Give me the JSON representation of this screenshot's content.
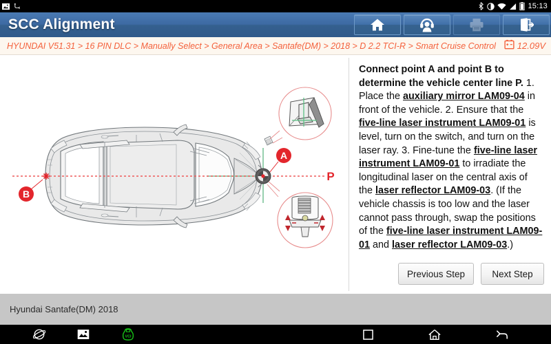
{
  "status_bar": {
    "icons": [
      "image-icon",
      "usb-debug-icon",
      "bluetooth-icon",
      "do-not-disturb-icon",
      "wifi-icon",
      "signal-icon",
      "battery-icon"
    ],
    "time": "15:13"
  },
  "header": {
    "title": "SCC Alignment",
    "buttons": [
      {
        "name": "home-button",
        "icon": "home-icon",
        "enabled": true
      },
      {
        "name": "support-button",
        "icon": "headset-icon",
        "enabled": true
      },
      {
        "name": "print-button",
        "icon": "printer-icon",
        "enabled": false
      },
      {
        "name": "exit-button",
        "icon": "exit-icon",
        "enabled": true
      }
    ]
  },
  "breadcrumb": {
    "path": "HYUNDAI V51.31 > 16 PIN DLC > Manually Select > General Area > Santafe(DM) > 2018 > D 2.2 TCI-R > Smart Cruise Control",
    "voltage": "12.09V",
    "voltage_icon": "battery-icon",
    "accent_color": "#f4613c"
  },
  "diagram": {
    "title": "vehicle-top-view-scc-alignment",
    "labels": {
      "point_a": "A",
      "point_b": "B",
      "center_line": "P"
    },
    "callouts": [
      {
        "name": "auxiliary-mirror-callout",
        "depicts": "auxiliary mirror LAM09-04"
      },
      {
        "name": "laser-instrument-callout",
        "depicts": "five-line laser instrument LAM09-01 tripod adjustment"
      }
    ],
    "colors": {
      "marker": "#e3262c",
      "center_line": "#ee5a5a",
      "laser_green": "#4cae6a",
      "callout_outline": "#e78b8b",
      "car_fill": "#e9e9e9",
      "car_stroke": "#6f7578"
    }
  },
  "instructions": {
    "heading": "Connect point A and point B to determine the vehicle center line P.",
    "steps": [
      {
        "number": "1.",
        "parts": [
          {
            "text": "Place the ",
            "style": "normal"
          },
          {
            "text": "auxiliary mirror LAM09-04",
            "style": "highlight"
          },
          {
            "text": " in front of the vehicle.",
            "style": "normal"
          }
        ]
      },
      {
        "number": "2.",
        "parts": [
          {
            "text": "Ensure that the ",
            "style": "normal"
          },
          {
            "text": "five-line laser instrument LAM09-01",
            "style": "highlight"
          },
          {
            "text": " is level, turn on the switch, and turn on the laser ray.",
            "style": "normal"
          }
        ]
      },
      {
        "number": "3.",
        "parts": [
          {
            "text": "Fine-tune the ",
            "style": "normal"
          },
          {
            "text": "five-line laser instrument LAM09-01",
            "style": "highlight"
          },
          {
            "text": " to irradiate the longitudinal laser on the central axis of the ",
            "style": "normal"
          },
          {
            "text": "laser reflector LAM09-03",
            "style": "highlight"
          },
          {
            "text": ". (If the vehicle chassis is too low and the laser cannot pass through, swap the positions of the ",
            "style": "normal"
          },
          {
            "text": "five-line laser instrument LAM09-01",
            "style": "highlight"
          },
          {
            "text": " and ",
            "style": "normal"
          },
          {
            "text": "laser reflector LAM09-03",
            "style": "highlight"
          },
          {
            "text": ".)",
            "style": "normal"
          }
        ]
      }
    ],
    "previous_button": "Previous Step",
    "next_button": "Next Step"
  },
  "footer": {
    "vehicle": "Hyundai Santafe(DM) 2018"
  },
  "nav_bar": {
    "left_icons": [
      "browser-icon",
      "screenshot-icon",
      "vci-icon"
    ],
    "right_icons": [
      "recent-apps-icon",
      "home-icon",
      "back-icon"
    ],
    "vci_color": "#17c117"
  }
}
